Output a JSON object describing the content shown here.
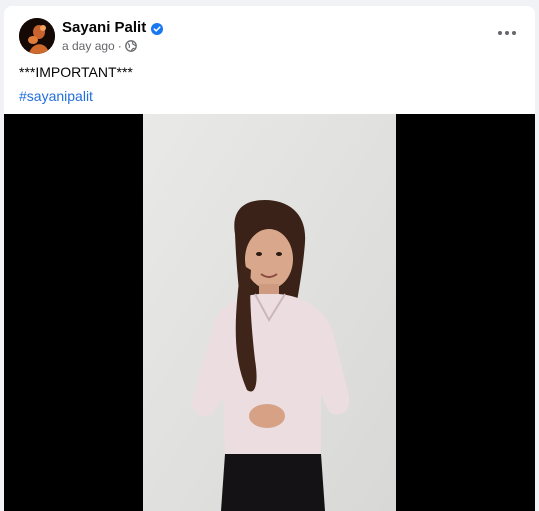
{
  "post": {
    "author": {
      "name": "Sayani Palit",
      "verified": true,
      "avatar_icon": "profile-photo"
    },
    "timestamp": "a day ago",
    "audience_icon": "globe-icon",
    "more_icon": "more-options-icon",
    "text": "***IMPORTANT***",
    "hashtag": "#sayanipalit",
    "media": {
      "type": "video",
      "background": "#000000"
    }
  },
  "colors": {
    "accent": "#1877f2",
    "hashtag": "#216fdb",
    "secondary_text": "#65676b",
    "page_background": "#f0f2f5"
  }
}
